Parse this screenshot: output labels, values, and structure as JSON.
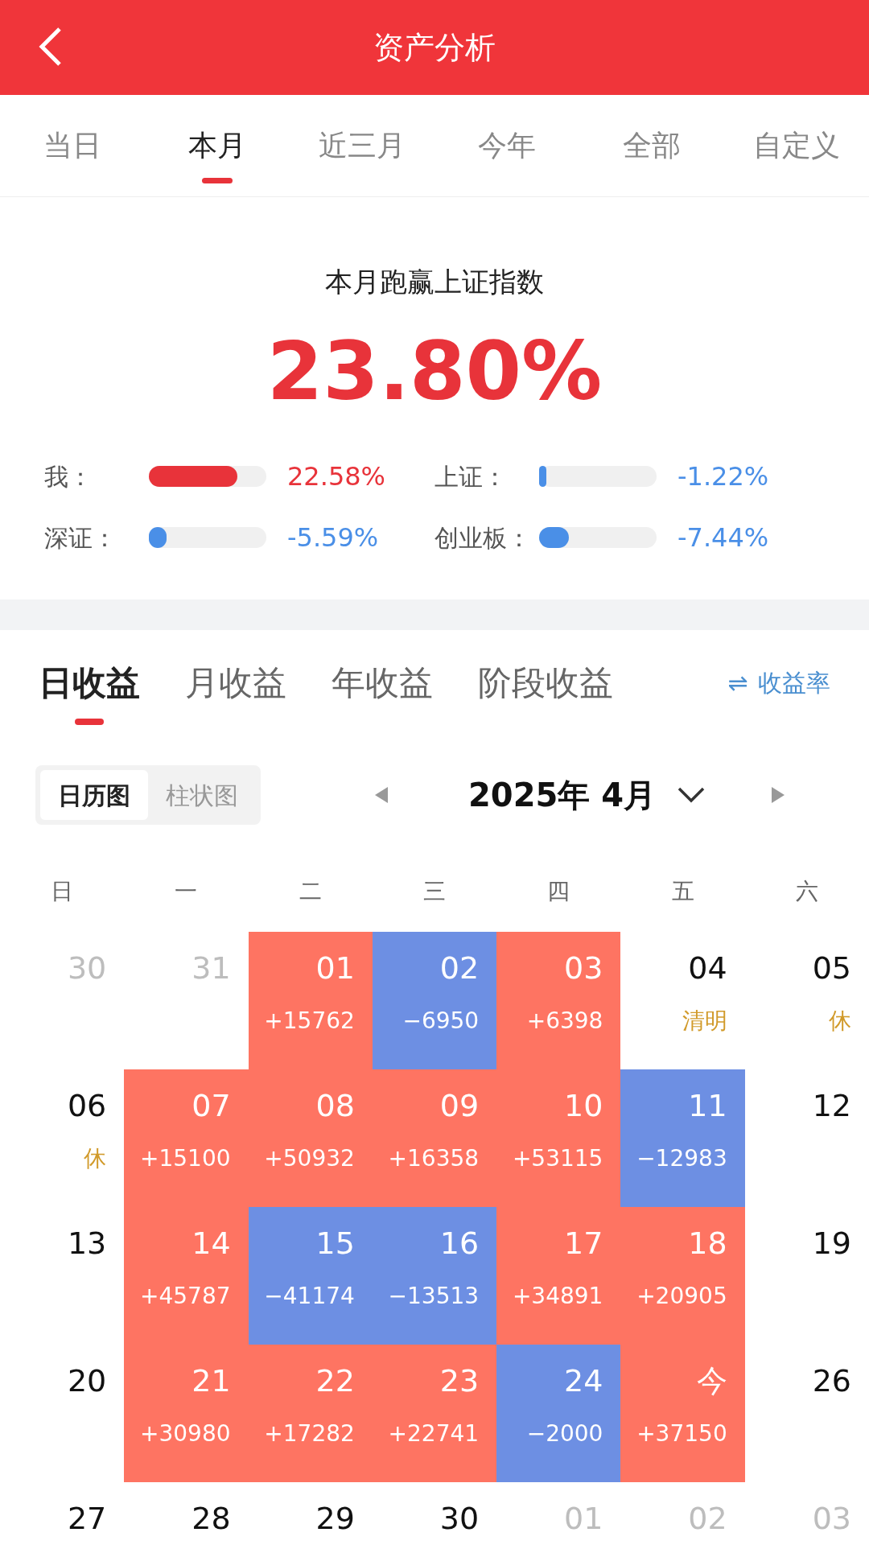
{
  "header": {
    "title": "资产分析"
  },
  "period_tabs": [
    {
      "label": "当日",
      "selected": false
    },
    {
      "label": "本月",
      "selected": true
    },
    {
      "label": "近三月",
      "selected": false
    },
    {
      "label": "今年",
      "selected": false
    },
    {
      "label": "全部",
      "selected": false
    },
    {
      "label": "自定义",
      "selected": false
    }
  ],
  "summary": {
    "title": "本月跑赢上证指数",
    "value": "23.80%"
  },
  "comparisons": [
    {
      "name": "我：",
      "level": 0.75,
      "reading": "22.58%",
      "color": "#e8333a"
    },
    {
      "name": "上证：",
      "level": 0.05,
      "reading": "-1.22%",
      "color": "#4a8fe7"
    },
    {
      "name": "深证：",
      "level": 0.15,
      "reading": "-5.59%",
      "color": "#4a8fe7"
    },
    {
      "name": "创业板：",
      "level": 0.25,
      "reading": "-7.44%",
      "color": "#4a8fe7"
    }
  ],
  "income_tabs": [
    {
      "label": "日收益",
      "selected": true
    },
    {
      "label": "月收益",
      "selected": false
    },
    {
      "label": "年收益",
      "selected": false
    },
    {
      "label": "阶段收益",
      "selected": false
    }
  ],
  "rate_toggle": {
    "icon": "⇌",
    "label": "收益率"
  },
  "view_toggle": [
    {
      "label": "日历图",
      "selected": true
    },
    {
      "label": "柱状图",
      "selected": false
    }
  ],
  "month": {
    "label": "2025年 4月"
  },
  "weekdays": [
    "日",
    "一",
    "二",
    "三",
    "四",
    "五",
    "六"
  ],
  "days": [
    {
      "day": "30",
      "kind": "other"
    },
    {
      "day": "31",
      "kind": "other"
    },
    {
      "day": "01",
      "kind": "gain",
      "amount": "+15762"
    },
    {
      "day": "02",
      "kind": "loss",
      "amount": "−6950"
    },
    {
      "day": "03",
      "kind": "gain",
      "amount": "+6398"
    },
    {
      "day": "04",
      "kind": "plain",
      "note": "清明"
    },
    {
      "day": "05",
      "kind": "plain",
      "note": "休"
    },
    {
      "day": "06",
      "kind": "plain",
      "note": "休"
    },
    {
      "day": "07",
      "kind": "gain",
      "amount": "+15100"
    },
    {
      "day": "08",
      "kind": "gain",
      "amount": "+50932"
    },
    {
      "day": "09",
      "kind": "gain",
      "amount": "+16358"
    },
    {
      "day": "10",
      "kind": "gain",
      "amount": "+53115"
    },
    {
      "day": "11",
      "kind": "loss",
      "amount": "−12983"
    },
    {
      "day": "12",
      "kind": "plain"
    },
    {
      "day": "13",
      "kind": "plain"
    },
    {
      "day": "14",
      "kind": "gain",
      "amount": "+45787"
    },
    {
      "day": "15",
      "kind": "loss",
      "amount": "−41174"
    },
    {
      "day": "16",
      "kind": "loss",
      "amount": "−13513"
    },
    {
      "day": "17",
      "kind": "gain",
      "amount": "+34891"
    },
    {
      "day": "18",
      "kind": "gain",
      "amount": "+20905"
    },
    {
      "day": "19",
      "kind": "plain"
    },
    {
      "day": "20",
      "kind": "plain"
    },
    {
      "day": "21",
      "kind": "gain",
      "amount": "+30980"
    },
    {
      "day": "22",
      "kind": "gain",
      "amount": "+17282"
    },
    {
      "day": "23",
      "kind": "gain",
      "amount": "+22741"
    },
    {
      "day": "24",
      "kind": "loss",
      "amount": "−2000"
    },
    {
      "day": "今",
      "kind": "gain",
      "amount": "+37150"
    },
    {
      "day": "26",
      "kind": "plain"
    },
    {
      "day": "27",
      "kind": "plain"
    },
    {
      "day": "28",
      "kind": "plain"
    },
    {
      "day": "29",
      "kind": "plain"
    },
    {
      "day": "30",
      "kind": "plain"
    },
    {
      "day": "01",
      "kind": "other"
    },
    {
      "day": "02",
      "kind": "other"
    },
    {
      "day": "03",
      "kind": "other"
    }
  ]
}
